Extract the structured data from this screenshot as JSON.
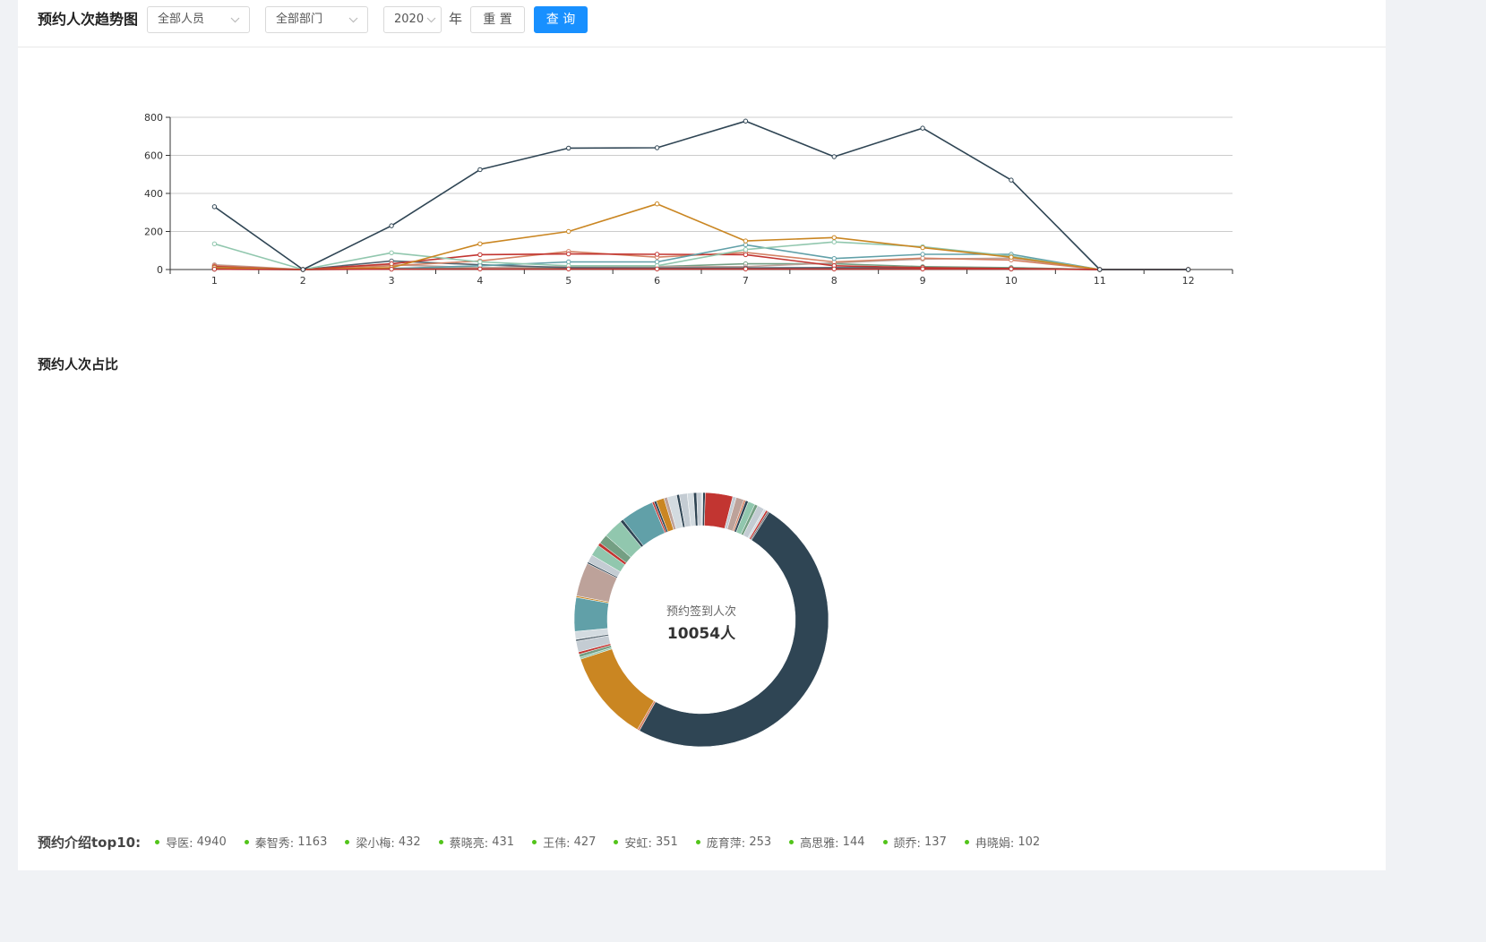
{
  "filter_bar": {
    "title": "预约人次趋势图",
    "person_select": {
      "value": "全部人员",
      "icon": "chevron-down-icon"
    },
    "dept_select": {
      "value": "全部部门",
      "icon": "chevron-down-icon"
    },
    "year_select": {
      "value": "2020",
      "icon": "chevron-down-icon"
    },
    "year_suffix": "年",
    "reset_label": "重 置",
    "query_label": "查 询"
  },
  "ratio_section": {
    "title": "预约人次占比"
  },
  "top10": {
    "title": "预约介绍top10:",
    "dot_color": "#52c41a",
    "items": [
      {
        "name": "导医",
        "count": 4940
      },
      {
        "name": "秦智秀",
        "count": 1163
      },
      {
        "name": "梁小梅",
        "count": 432
      },
      {
        "name": "蔡晓亮",
        "count": 431
      },
      {
        "name": "王伟",
        "count": 427
      },
      {
        "name": "安虹",
        "count": 351
      },
      {
        "name": "庞育萍",
        "count": 253
      },
      {
        "name": "高思雅",
        "count": 144
      },
      {
        "name": "颉乔",
        "count": 137
      },
      {
        "name": "冉晓娟",
        "count": 102
      }
    ]
  },
  "colors": {
    "primary": "#1890ff",
    "page_bg": "#f0f2f5",
    "card_bg": "#ffffff"
  },
  "chart_data": [
    {
      "type": "line",
      "categories": [
        "1",
        "2",
        "3",
        "4",
        "5",
        "6",
        "7",
        "8",
        "9",
        "10",
        "11",
        "12"
      ],
      "ylim": [
        0,
        800
      ],
      "yticks": [
        "0",
        "200",
        "400",
        "600",
        "800"
      ],
      "grid": true,
      "series": [
        {
          "color": "#c4ccd3",
          "values": [
            8,
            0,
            8,
            8,
            8,
            8,
            10,
            10,
            10,
            10,
            0,
            0
          ]
        },
        {
          "color": "#6e7074",
          "values": [
            3,
            0,
            3,
            5,
            5,
            5,
            5,
            5,
            5,
            5,
            0,
            0
          ]
        },
        {
          "color": "#749f83",
          "values": [
            5,
            0,
            5,
            5,
            10,
            15,
            30,
            30,
            15,
            10,
            0,
            0
          ]
        },
        {
          "color": "#bda29a",
          "values": [
            25,
            0,
            25,
            10,
            15,
            15,
            15,
            35,
            55,
            60,
            0,
            0
          ]
        },
        {
          "color": "#546570",
          "values": [
            2,
            0,
            45,
            25,
            10,
            8,
            8,
            10,
            10,
            3,
            0,
            0
          ]
        },
        {
          "color": "#d48265",
          "values": [
            20,
            0,
            20,
            45,
            95,
            65,
            90,
            40,
            60,
            50,
            0,
            0
          ]
        },
        {
          "color": "#c23531",
          "values": [
            15,
            0,
            30,
            78,
            82,
            80,
            78,
            20,
            10,
            5,
            0,
            0
          ]
        },
        {
          "color": "#61a0a8",
          "values": [
            10,
            0,
            5,
            20,
            40,
            40,
            130,
            58,
            80,
            80,
            0,
            0
          ]
        },
        {
          "color": "#91c7ae",
          "values": [
            135,
            0,
            88,
            40,
            20,
            20,
            105,
            145,
            120,
            70,
            0,
            0
          ]
        },
        {
          "color": "#ca8622",
          "values": [
            10,
            0,
            10,
            135,
            200,
            345,
            150,
            168,
            115,
            65,
            0,
            0
          ]
        },
        {
          "color": "#c23531",
          "values": [
            2,
            0,
            2,
            3,
            3,
            3,
            3,
            3,
            3,
            3,
            0,
            0
          ]
        },
        {
          "color": "#2f4554",
          "values": [
            330,
            0,
            230,
            525,
            638,
            640,
            780,
            593,
            743,
            470,
            0,
            0
          ]
        }
      ]
    },
    {
      "type": "pie",
      "donut": true,
      "center_label": "预约签到人次",
      "center_value": "10054人",
      "total": 10054,
      "slices": [
        {
          "value": 20,
          "color": "#d3dbe0"
        },
        {
          "value": 30,
          "color": "#2f4554"
        },
        {
          "value": 351,
          "color": "#c23531"
        },
        {
          "value": 45,
          "color": "#c4ccd3"
        },
        {
          "value": 100,
          "color": "#bda29a"
        },
        {
          "value": 25,
          "color": "#d48265"
        },
        {
          "value": 35,
          "color": "#2f4554"
        },
        {
          "value": 90,
          "color": "#91c7ae"
        },
        {
          "value": 40,
          "color": "#749f83"
        },
        {
          "value": 90,
          "color": "#c4ccd3"
        },
        {
          "value": 30,
          "color": "#d3dbe0"
        },
        {
          "value": 25,
          "color": "#c23531"
        },
        {
          "value": 20,
          "color": "#6e7074"
        },
        {
          "value": 4940,
          "color": "#2f4554"
        },
        {
          "value": 30,
          "color": "#d48265"
        },
        {
          "value": 1163,
          "color": "#ca8622"
        },
        {
          "value": 25,
          "color": "#91c7ae"
        },
        {
          "value": 40,
          "color": "#749f83"
        },
        {
          "value": 30,
          "color": "#c23531"
        },
        {
          "value": 137,
          "color": "#c4ccd3"
        },
        {
          "value": 25,
          "color": "#546570"
        },
        {
          "value": 100,
          "color": "#d3dbe0"
        },
        {
          "value": 432,
          "color": "#61a0a8"
        },
        {
          "value": 20,
          "color": "#ca8622"
        },
        {
          "value": 431,
          "color": "#bda29a"
        },
        {
          "value": 20,
          "color": "#2f4554"
        },
        {
          "value": 100,
          "color": "#c4ccd3"
        },
        {
          "value": 144,
          "color": "#91c7ae"
        },
        {
          "value": 40,
          "color": "#c23531"
        },
        {
          "value": 120,
          "color": "#749f83"
        },
        {
          "value": 253,
          "color": "#91c7ae"
        },
        {
          "value": 40,
          "color": "#2f4554"
        },
        {
          "value": 427,
          "color": "#61a0a8"
        },
        {
          "value": 25,
          "color": "#c23531"
        },
        {
          "value": 30,
          "color": "#2f4554"
        },
        {
          "value": 102,
          "color": "#ca8622"
        },
        {
          "value": 45,
          "color": "#bda29a"
        },
        {
          "value": 120,
          "color": "#d3dbe0"
        },
        {
          "value": 35,
          "color": "#2f4554"
        },
        {
          "value": 100,
          "color": "#c4ccd3"
        },
        {
          "value": 80,
          "color": "#d3dbe0"
        },
        {
          "value": 40,
          "color": "#2f4554"
        },
        {
          "value": 59,
          "color": "#c4ccd3"
        }
      ]
    }
  ]
}
